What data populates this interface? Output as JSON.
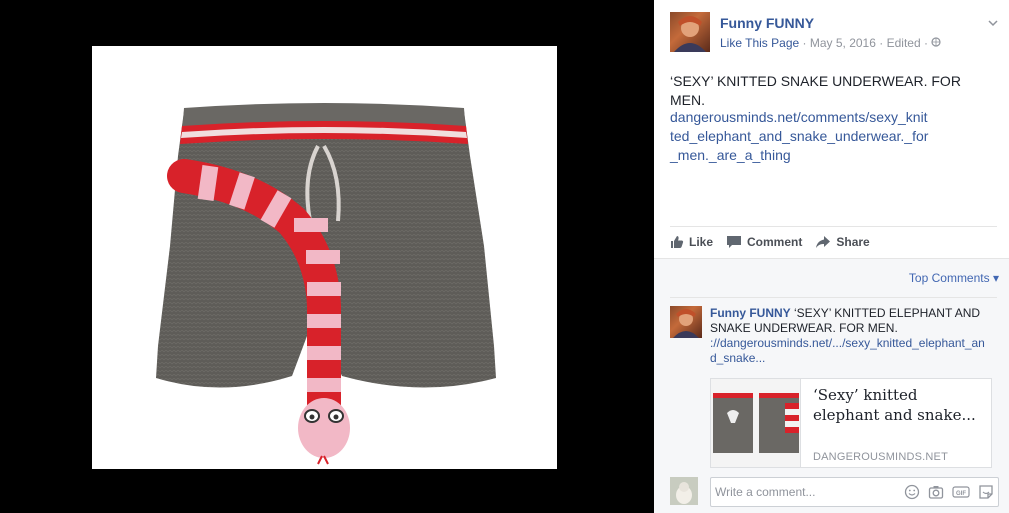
{
  "post": {
    "page_name": "Funny FUNNY",
    "like_page": "Like This Page",
    "date": "May 5, 2016",
    "edited": "Edited",
    "separator": "·",
    "text": "‘SEXY’ KNITTED SNAKE UNDERWEAR. FOR MEN.",
    "link": "dangerousminds.net/comments/sexy_knitted_elephant_and_snake_underwear._for_men._are_a_thing"
  },
  "actions": {
    "like": "Like",
    "comment": "Comment",
    "share": "Share"
  },
  "comments": {
    "sort_label": "Top Comments",
    "items": [
      {
        "author": "Funny FUNNY",
        "text": "‘SEXY’ KNITTED ELEPHANT AND SNAKE UNDERWEAR. FOR MEN.",
        "link": "://dangerousminds.net/.../sexy_knitted_elephant_and_snake...",
        "preview_title": "‘Sexy’ knitted elephant and snake...",
        "preview_domain": "DANGEROUSMINDS.NET"
      }
    ],
    "write_placeholder": "Write a comment..."
  },
  "colors": {
    "link": "#365899",
    "muted": "#90949c",
    "knit_gray": "#5e5c58",
    "stripe_red": "#d8222a",
    "stripe_pink": "#f2b8c6"
  },
  "icons": [
    "chevron-down-icon",
    "globe-icon",
    "thumbs-up-icon",
    "comment-icon",
    "share-icon",
    "emoji-icon",
    "camera-icon",
    "gif-icon",
    "sticker-icon"
  ]
}
